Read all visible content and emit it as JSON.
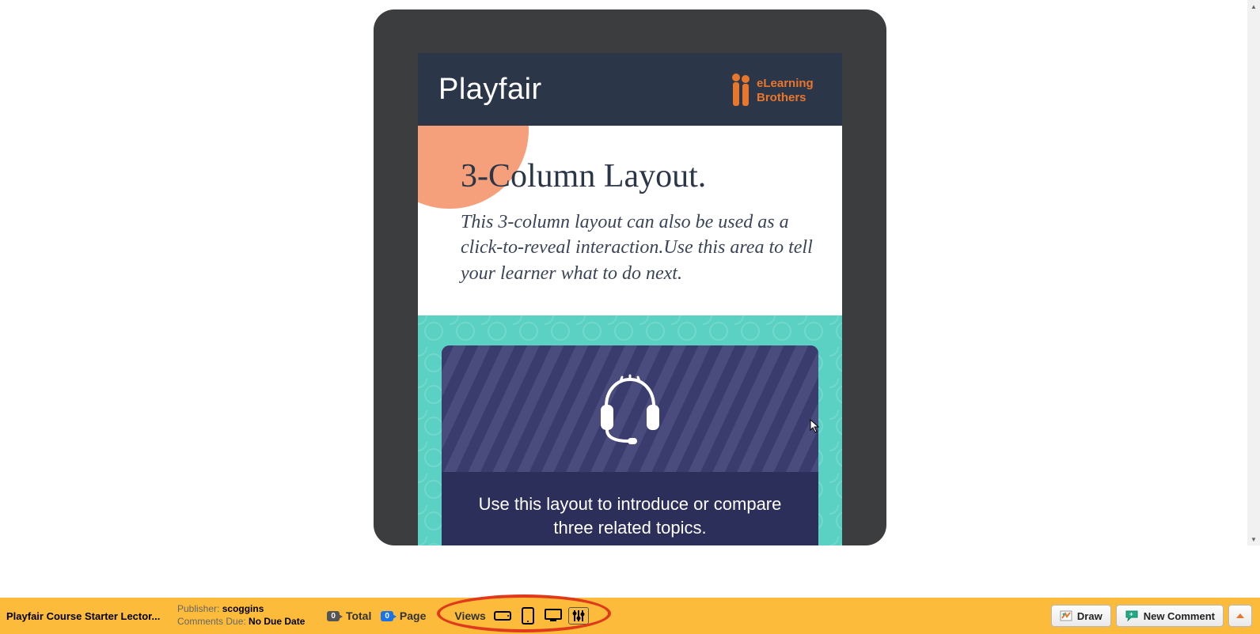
{
  "course": {
    "header_title": "Playfair",
    "brand_name": "eLearning Brothers",
    "heading": "3-Column Layout.",
    "subheading": "This 3-column layout can also be used as a click-to-reveal interaction.Use this area to tell your learner what to do next.",
    "card_text": "Use this layout to introduce or compare three related topics."
  },
  "toolbar": {
    "course_name": "Playfair Course Starter Lector...",
    "publisher_label": "Publisher:",
    "publisher_value": "scoggins",
    "comments_due_label": "Comments Due:",
    "comments_due_value": "No Due Date",
    "total_count": "0",
    "total_label": "Total",
    "page_count": "0",
    "page_label": "Page",
    "views_label": "Views",
    "draw_label": "Draw",
    "new_comment_label": "New Comment"
  },
  "colors": {
    "device_frame": "#3b3d3f",
    "header_bg": "#2b3648",
    "peach": "#f5a07a",
    "teal": "#5ad1c3",
    "card_bg": "#3b3c6e",
    "card_bottom": "#2b2f5a",
    "toolbar_bg": "#fcbb3a",
    "annotation_red": "#e03a1c",
    "brand_orange": "#e8762c"
  },
  "icons": {
    "headset": "headset-icon",
    "phone_landscape": "phone-landscape-icon",
    "tablet": "tablet-portrait-icon",
    "desktop": "desktop-icon",
    "sliders": "sliders-icon",
    "draw": "draw-icon",
    "comment": "comment-icon",
    "expand": "expand-up-icon"
  }
}
